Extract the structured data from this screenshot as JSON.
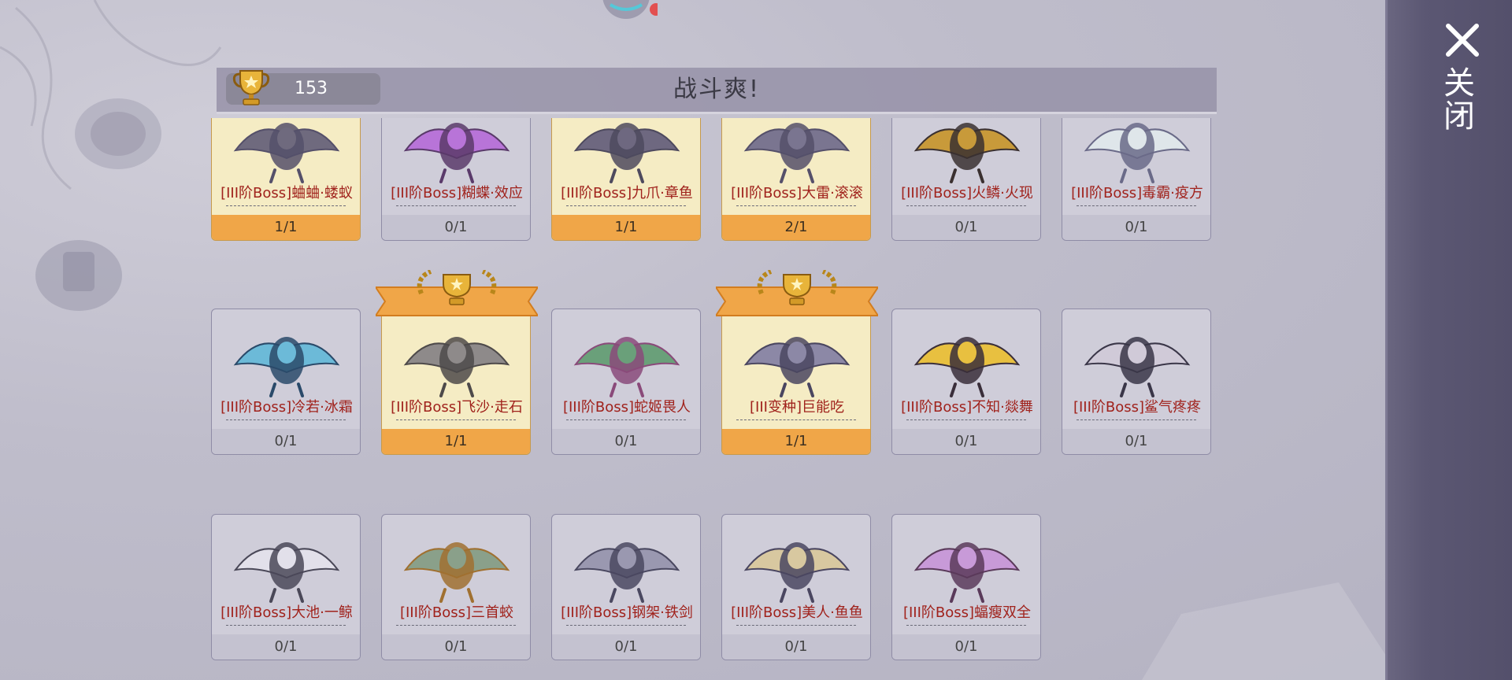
{
  "header": {
    "score": "153",
    "title": "战斗爽!"
  },
  "close": {
    "label": "关闭"
  },
  "colors": {
    "accent_gold": "#f0a648",
    "name_red": "#a0221c",
    "panel": "#5b5773"
  },
  "cards": [
    {
      "name": "[III阶Boss]蛐蛐·蝼蚁",
      "progress": "1/1",
      "completed": true,
      "icon": "beetle-boss-icon"
    },
    {
      "name": "[III阶Boss]糊蝶·效应",
      "progress": "0/1",
      "completed": false,
      "icon": "butterfly-boss-icon"
    },
    {
      "name": "[III阶Boss]九爪·章鱼",
      "progress": "1/1",
      "completed": true,
      "icon": "octopus-boss-icon"
    },
    {
      "name": "[III阶Boss]大雷·滚滚",
      "progress": "2/1",
      "completed": true,
      "icon": "bug-boss-icon"
    },
    {
      "name": "[III阶Boss]火鳞·火现",
      "progress": "0/1",
      "completed": false,
      "icon": "fire-dragon-boss-icon"
    },
    {
      "name": "[III阶Boss]毒霸·疫方",
      "progress": "0/1",
      "completed": false,
      "icon": "poison-wasp-boss-icon"
    },
    {
      "name": "[III阶Boss]冷若·冰霜",
      "progress": "0/1",
      "completed": false,
      "icon": "ice-dragon-boss-icon"
    },
    {
      "name": "[III阶Boss]飞沙·走石",
      "progress": "1/1",
      "completed": true,
      "icon": "sand-bat-boss-icon",
      "ribbon": true
    },
    {
      "name": "[III阶Boss]蛇姬畏人",
      "progress": "0/1",
      "completed": false,
      "icon": "snake-lady-boss-icon"
    },
    {
      "name": "[III变种]巨能吃",
      "progress": "1/1",
      "completed": true,
      "icon": "blob-mutant-icon",
      "ribbon": true
    },
    {
      "name": "[III阶Boss]不知·燚舞",
      "progress": "0/1",
      "completed": false,
      "icon": "fire-dancer-boss-icon"
    },
    {
      "name": "[III阶Boss]鲨气疼疼",
      "progress": "0/1",
      "completed": false,
      "icon": "shark-boss-icon"
    },
    {
      "name": "[III阶Boss]大池·一鲸",
      "progress": "0/1",
      "completed": false,
      "icon": "whale-boss-icon"
    },
    {
      "name": "[III阶Boss]三首蛟",
      "progress": "0/1",
      "completed": false,
      "icon": "three-headed-serpent-icon"
    },
    {
      "name": "[III阶Boss]钢架·铁剑",
      "progress": "0/1",
      "completed": false,
      "icon": "steel-mech-boss-icon"
    },
    {
      "name": "[III阶Boss]美人·鱼鱼",
      "progress": "0/1",
      "completed": false,
      "icon": "mermaid-boss-icon"
    },
    {
      "name": "[III阶Boss]蝠瘦双全",
      "progress": "0/1",
      "completed": false,
      "icon": "bat-boss-icon"
    }
  ]
}
